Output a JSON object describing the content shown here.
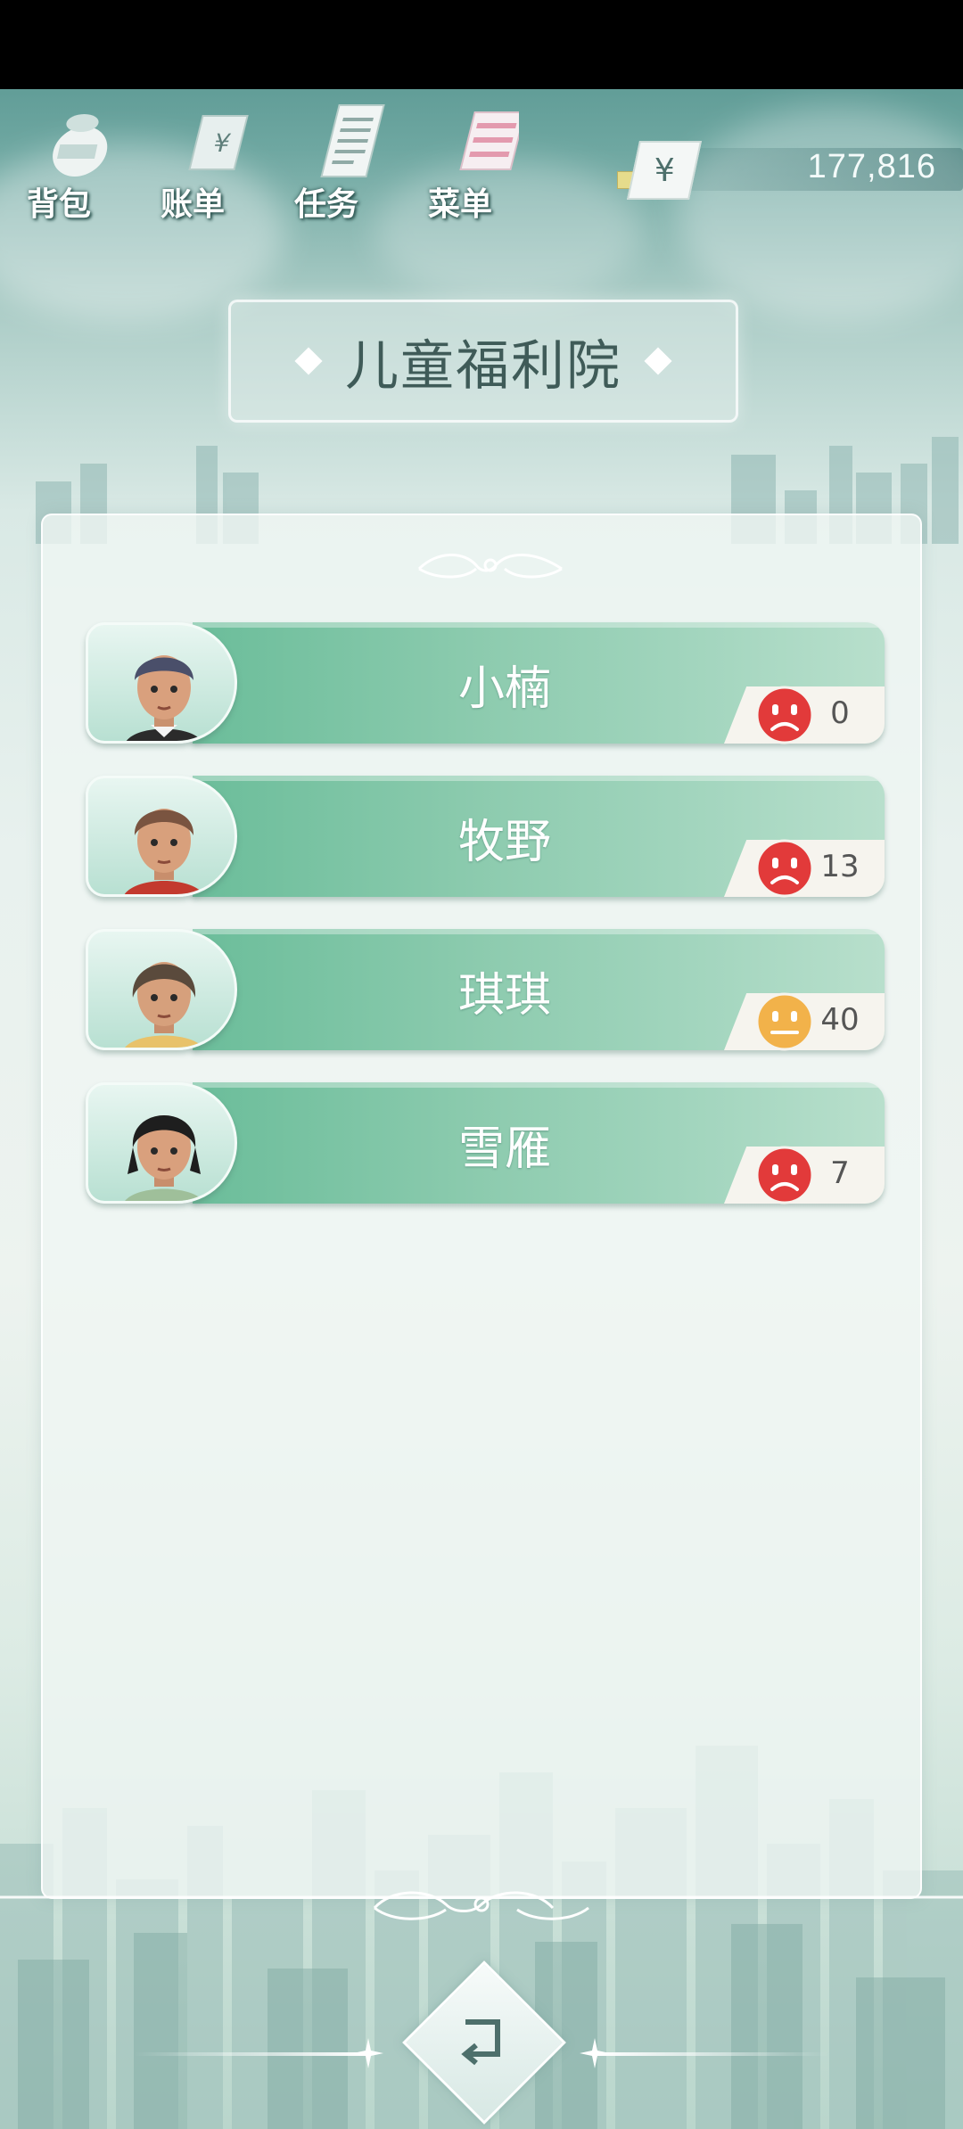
{
  "toolbar": {
    "items": [
      {
        "label": "背包",
        "icon": "backpack-icon"
      },
      {
        "label": "账单",
        "icon": "bill-icon"
      },
      {
        "label": "任务",
        "icon": "task-icon"
      },
      {
        "label": "菜单",
        "icon": "menu-icon"
      }
    ]
  },
  "money": {
    "symbol": "¥",
    "amount": "177,816"
  },
  "title": "儿童福利院",
  "children": [
    {
      "name": "小楠",
      "mood": "sad",
      "mood_color": "#e23a3a",
      "score": "0"
    },
    {
      "name": "牧野",
      "mood": "sad",
      "mood_color": "#e23a3a",
      "score": "13"
    },
    {
      "name": "琪琪",
      "mood": "neutral",
      "mood_color": "#f2b24a",
      "score": "40"
    },
    {
      "name": "雪雁",
      "mood": "sad",
      "mood_color": "#e23a3a",
      "score": "7"
    }
  ],
  "colors": {
    "plate_green": "#8fccb0",
    "title_text": "#3f5b58",
    "status_bar": "#000000"
  },
  "bottom": {
    "back_icon": "back-arrow-icon"
  }
}
